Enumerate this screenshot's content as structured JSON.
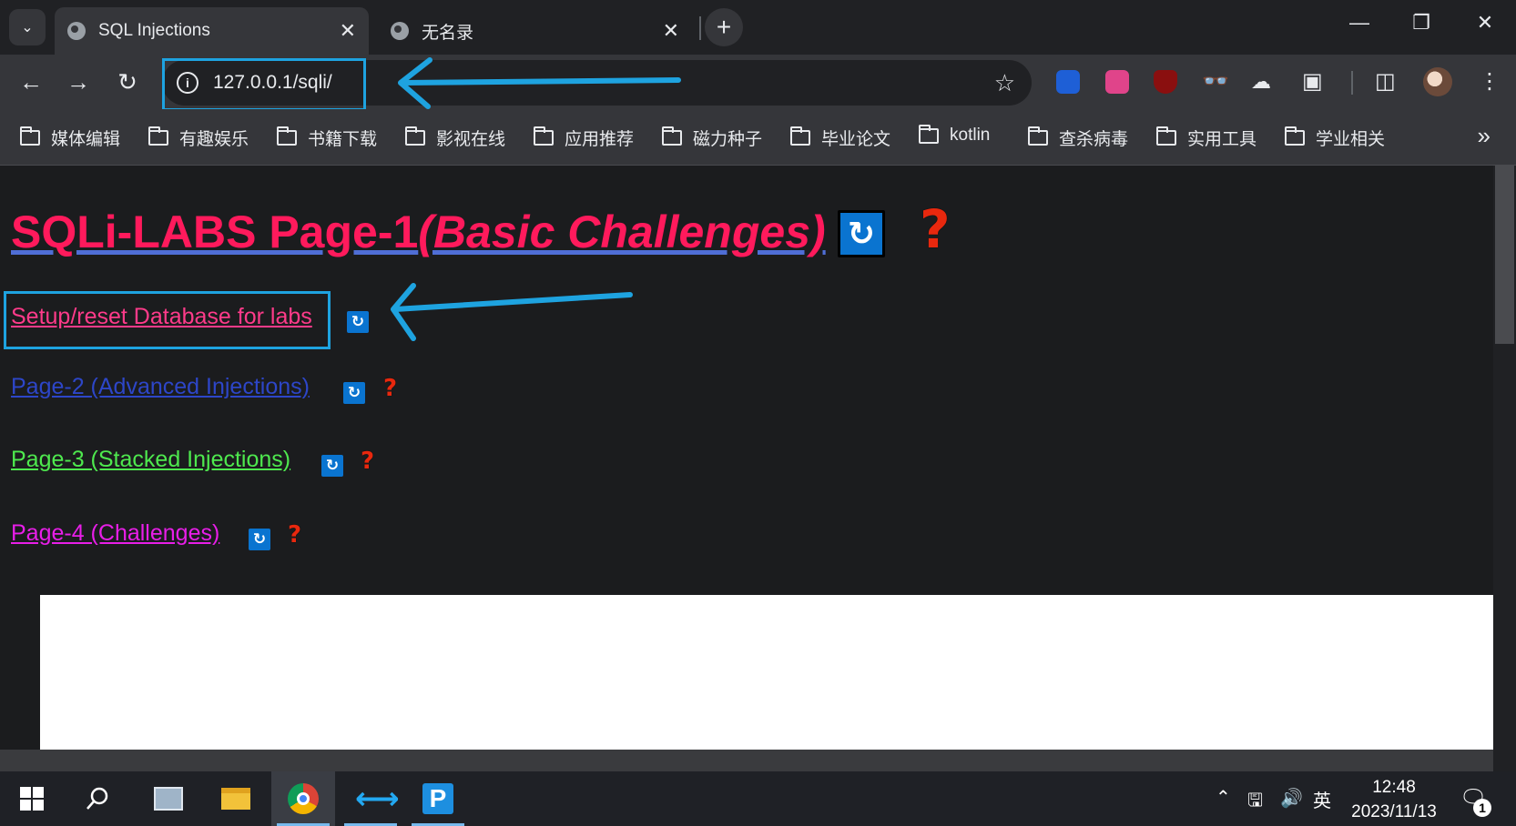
{
  "browser": {
    "tabs": [
      {
        "title": "SQL Injections",
        "active": true
      },
      {
        "title": "无名录",
        "active": false
      }
    ],
    "url": "127.0.0.1/sqli/",
    "bookmarks": [
      "媒体编辑",
      "有趣娱乐",
      "书籍下载",
      "影视在线",
      "应用推荐",
      "磁力种子",
      "毕业论文",
      "kotlin",
      "查杀病毒",
      "实用工具",
      "学业相关"
    ]
  },
  "page": {
    "heading_main": "SQLi-LABS Page-1",
    "heading_italic": "(Basic Challenges)",
    "links": [
      {
        "label": "Setup/reset Database for labs",
        "color": "#ff3b8a"
      },
      {
        "label": "Page-2 (Advanced Injections)",
        "color": "#2d46c8"
      },
      {
        "label": "Page-3 (Stacked Injections)",
        "color": "#4ee84e"
      },
      {
        "label": "Page-4 (Challenges)",
        "color": "#e81ee8"
      }
    ],
    "question_mark": "?"
  },
  "taskbar": {
    "time": "12:48",
    "date": "2023/11/13",
    "ime": "英",
    "notification_count": "1"
  },
  "colors": {
    "annotation": "#1ea3e0",
    "heading": "#ff1a5c"
  }
}
